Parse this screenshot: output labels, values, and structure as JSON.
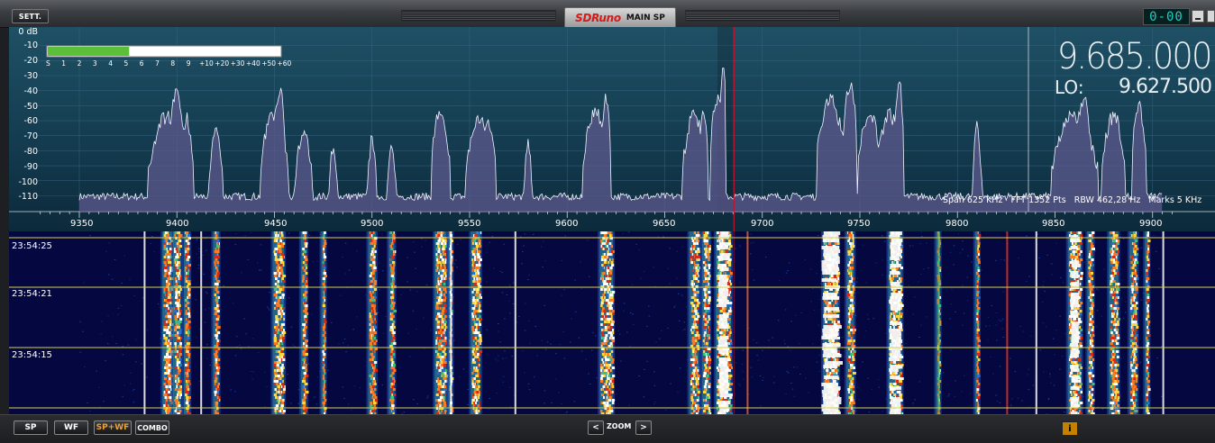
{
  "title_bar": {
    "settings_label": "SETT.",
    "logo_text": "SDRuno",
    "window_title": "MAIN SP",
    "mini_display": "0-00"
  },
  "spectrum": {
    "frequency_readout": "9.685.000",
    "lo_label": "LO:",
    "lo_value": "9.627.500",
    "info": {
      "span": "Span 625 KHz",
      "fft": "FFT 1352 Pts",
      "rbw": "RBW 462,28 Hz",
      "marks": "Marks 5 KHz"
    },
    "smeter_scale": [
      "S",
      "1",
      "2",
      "3",
      "4",
      "5",
      "6",
      "7",
      "8",
      "9",
      "+10",
      "+20",
      "+30",
      "+40",
      "+50",
      "+60"
    ],
    "smeter_level": 0.35,
    "db_labels": [
      "0 dB",
      "-10",
      "-20",
      "-30",
      "-40",
      "-50",
      "-60",
      "-70",
      "-80",
      "-90",
      "-100",
      "-110"
    ],
    "freq_labels": [
      "9350",
      "9400",
      "9450",
      "9500",
      "9550",
      "9600",
      "9650",
      "9700",
      "9750",
      "9800",
      "9850",
      "9900"
    ]
  },
  "waterfall": {
    "timestamps": [
      "23:54:25",
      "23:54:21",
      "23:54:15"
    ]
  },
  "bottom_bar": {
    "sp_label": "SP",
    "wf_label": "WF",
    "spwf_label": "SP+WF",
    "combo_label": "COMBO",
    "zoom_label": "ZOOM",
    "zoom_out": "<",
    "zoom_in": ">",
    "info_label": "i"
  },
  "colors": {
    "spectrum_fill": "#5e5a8e",
    "spectrum_line": "#f2f2ff",
    "tuning_cursor": "#c8102e",
    "smeter_bar": "#5cbf3a",
    "waterfall_background": "#050840",
    "time_marker": "#d7d24a",
    "spwf_active": "#f0a030"
  }
}
